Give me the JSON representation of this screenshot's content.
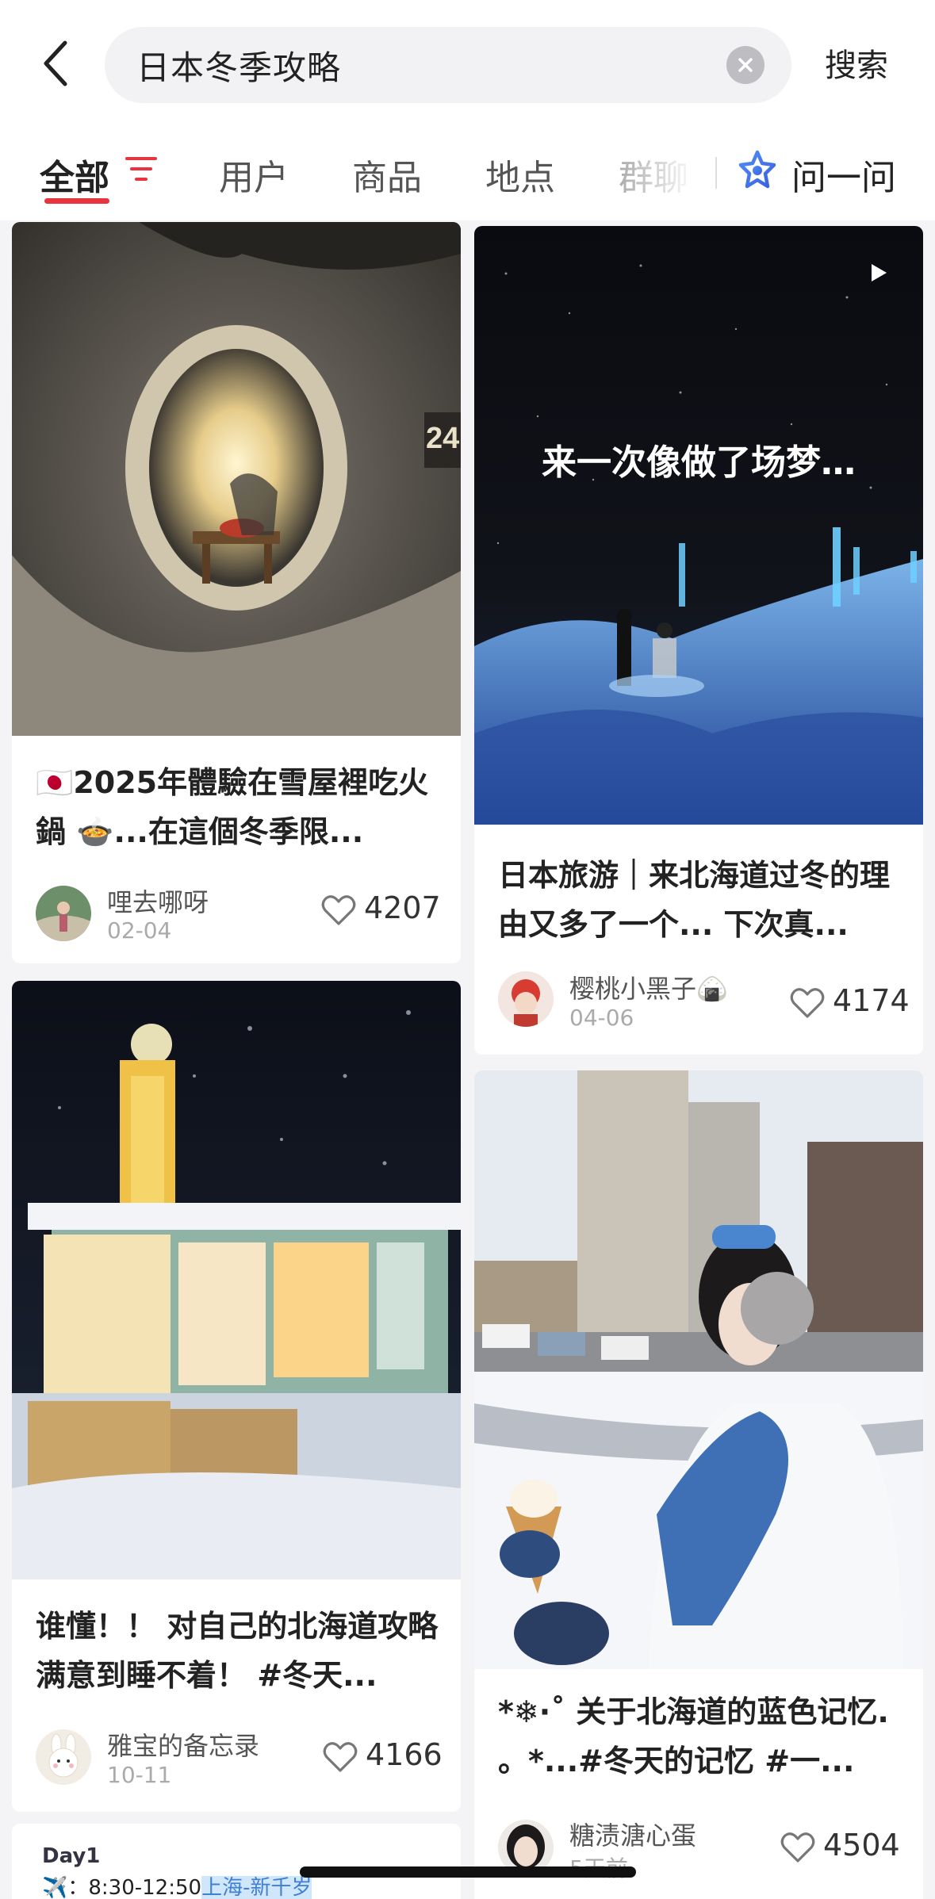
{
  "search": {
    "query": "日本冬季攻略",
    "action_label": "搜索"
  },
  "tabs": {
    "items": [
      {
        "label": "全部",
        "active": true
      },
      {
        "label": "用户"
      },
      {
        "label": "商品"
      },
      {
        "label": "地点"
      },
      {
        "label": "群聊"
      }
    ],
    "ask_label": "问一问"
  },
  "accent_color": "#e8343f",
  "posts": [
    {
      "title": "🇯🇵2025年體驗在雪屋裡吃火鍋 🍲...在這個冬季限...",
      "author": "哩去哪呀",
      "date": "02-04",
      "likes": "4207"
    },
    {
      "overlay_text": "来一次像做了场梦…",
      "title": "日本旅游｜来北海道过冬的理由又多了一个... 下次真...",
      "author": "樱桃小黑子🍙",
      "date": "04-06",
      "likes": "4174",
      "is_video": true
    },
    {
      "title": "谁懂！！ 对自己的北海道攻略满意到睡不着！ #冬天...",
      "author": "雅宝的备忘录",
      "date": "10-11",
      "likes": "4166"
    },
    {
      "title": "*❄·˚ 关于北海道的蓝色记忆. 。*...#冬天的记忆 #一...",
      "author": "糖渍溏心蛋",
      "date": "5天前",
      "likes": "4504"
    }
  ],
  "peek_post": {
    "line1": "Day1",
    "line2_prefix": "✈️：8:30-12:50",
    "line2_highlight": "上海-新千岁"
  }
}
